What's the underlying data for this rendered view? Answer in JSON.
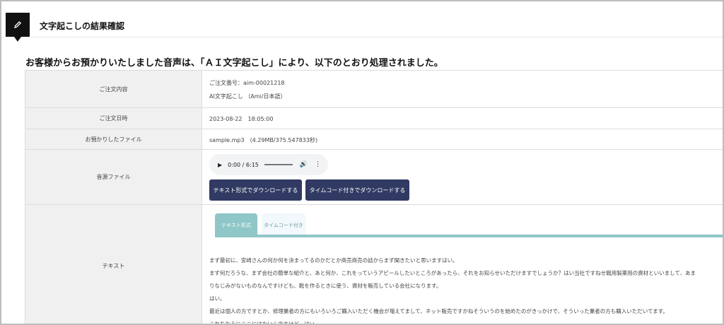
{
  "header": {
    "title": "文字起こしの結果確認",
    "icon": "pencil-icon"
  },
  "headline": "お客様からお預かりいたしました音声は、「ＡＩ文字起こし」により、以下のとおり処理されました。",
  "order_info": {
    "order_contents_label": "ご注文内容",
    "order_number": "ご注文番号：aim-00021218",
    "product": "AI文字起こし （Ami/日本語）",
    "order_date_label": "ご注文日時",
    "order_date": "2023-08-22　18:05:00",
    "file_label": "お預かりしたファイル",
    "file_value": "sample.mp3　(4.29MB/375.547833秒)",
    "source_label": "音源ファイル",
    "text_label": "テキスト"
  },
  "audio_player": {
    "time": "0:00 / 6:15",
    "progress": 0
  },
  "buttons": {
    "download_text": "テキスト形式でダウンロードする",
    "download_timecode": "タイムコード付きでダウンロードする"
  },
  "tabs": {
    "text_format": "テキスト形式",
    "timecode": "タイムコード付き",
    "active": "text_format"
  },
  "transcript": [
    "まず最初に、宮崎さんの何か何を決まってるのかだとか商売商売の話からまず聞きたいと思いますはい。",
    "まず何だろうな、まず会社の簡単な紹介と、あと何か、これをっていうアピールしたいところがあったら、それをお知らせいただけますでしょうか？はい当社ですねせ戦用製薬用の資材といいまして、あま",
    "りなじみがないものなんですけども、靴を作るときに使う、資材を販売している会社になります。",
    "はい。",
    "最近は個人の方ですとか、修理業者の方にもいろいろご購入いただく機会が増えてまして、ネット販売ですかねそういうのを始めたのがきっかけで、そういった業者の方も購入いただいてます。",
    "これちなみにここにはないんですけど、はい。"
  ],
  "colors": {
    "button": "#303a63",
    "tab_active": "#8fc6c7",
    "label_bg": "#f0f0f0"
  }
}
